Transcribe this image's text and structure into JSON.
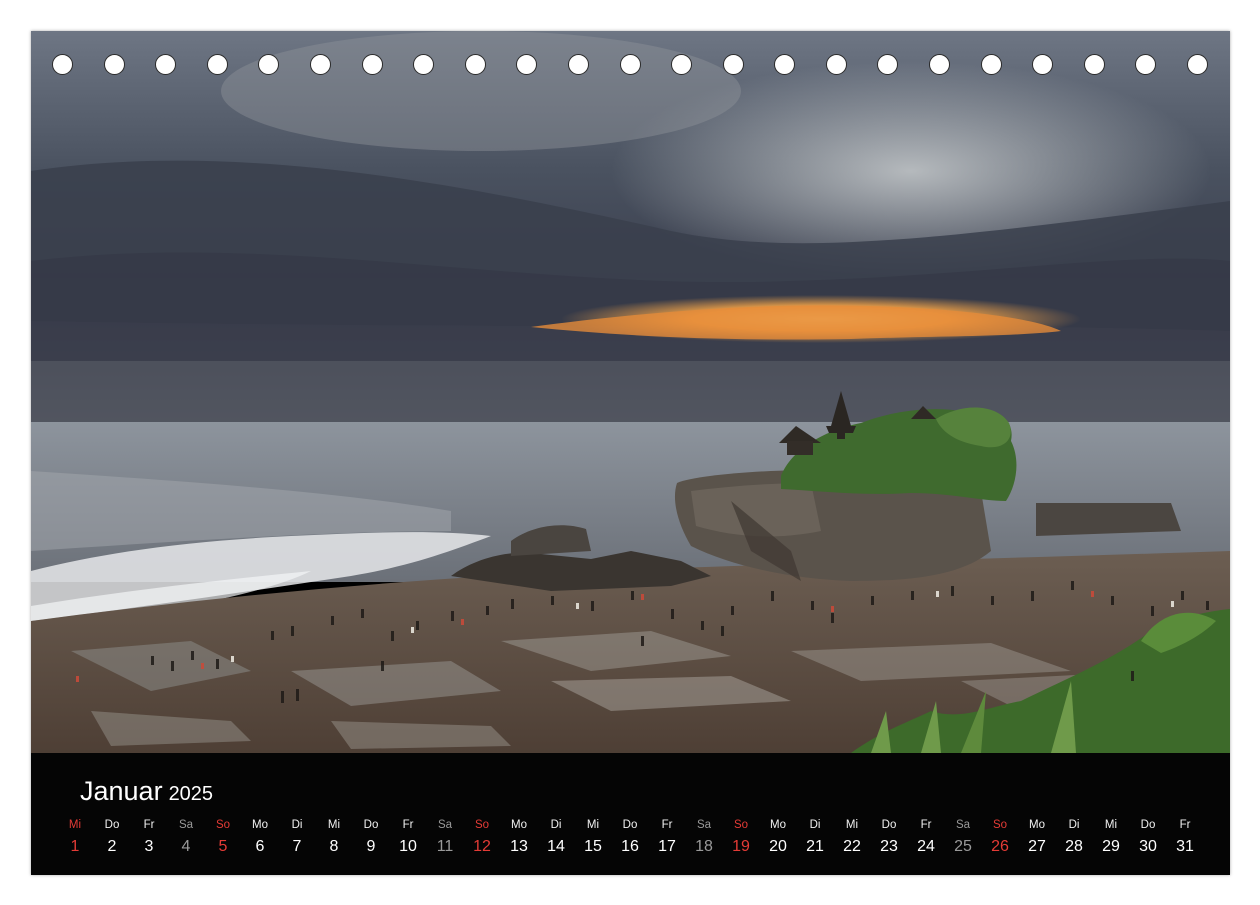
{
  "calendar": {
    "month": "Januar",
    "year": "2025",
    "sunday_color": "#e43b36",
    "saturday_color": "#9a9a9a",
    "days": [
      {
        "wd": "Mi",
        "n": "1",
        "type": "sun"
      },
      {
        "wd": "Do",
        "n": "2",
        "type": "normal"
      },
      {
        "wd": "Fr",
        "n": "3",
        "type": "normal"
      },
      {
        "wd": "Sa",
        "n": "4",
        "type": "sat"
      },
      {
        "wd": "So",
        "n": "5",
        "type": "sun"
      },
      {
        "wd": "Mo",
        "n": "6",
        "type": "normal"
      },
      {
        "wd": "Di",
        "n": "7",
        "type": "normal"
      },
      {
        "wd": "Mi",
        "n": "8",
        "type": "normal"
      },
      {
        "wd": "Do",
        "n": "9",
        "type": "normal"
      },
      {
        "wd": "Fr",
        "n": "10",
        "type": "normal"
      },
      {
        "wd": "Sa",
        "n": "11",
        "type": "sat"
      },
      {
        "wd": "So",
        "n": "12",
        "type": "sun"
      },
      {
        "wd": "Mo",
        "n": "13",
        "type": "normal"
      },
      {
        "wd": "Di",
        "n": "14",
        "type": "normal"
      },
      {
        "wd": "Mi",
        "n": "15",
        "type": "normal"
      },
      {
        "wd": "Do",
        "n": "16",
        "type": "normal"
      },
      {
        "wd": "Fr",
        "n": "17",
        "type": "normal"
      },
      {
        "wd": "Sa",
        "n": "18",
        "type": "sat"
      },
      {
        "wd": "So",
        "n": "19",
        "type": "sun"
      },
      {
        "wd": "Mo",
        "n": "20",
        "type": "normal"
      },
      {
        "wd": "Di",
        "n": "21",
        "type": "normal"
      },
      {
        "wd": "Mi",
        "n": "22",
        "type": "normal"
      },
      {
        "wd": "Do",
        "n": "23",
        "type": "normal"
      },
      {
        "wd": "Fr",
        "n": "24",
        "type": "normal"
      },
      {
        "wd": "Sa",
        "n": "25",
        "type": "sat"
      },
      {
        "wd": "So",
        "n": "26",
        "type": "sun"
      },
      {
        "wd": "Mo",
        "n": "27",
        "type": "normal"
      },
      {
        "wd": "Di",
        "n": "28",
        "type": "normal"
      },
      {
        "wd": "Mi",
        "n": "29",
        "type": "normal"
      },
      {
        "wd": "Do",
        "n": "30",
        "type": "normal"
      },
      {
        "wd": "Fr",
        "n": "31",
        "type": "normal"
      }
    ]
  },
  "binding": {
    "hole_count": 23
  },
  "photo": {
    "subject": "sea temple on rock at sunset with tourists on tidal flats"
  }
}
